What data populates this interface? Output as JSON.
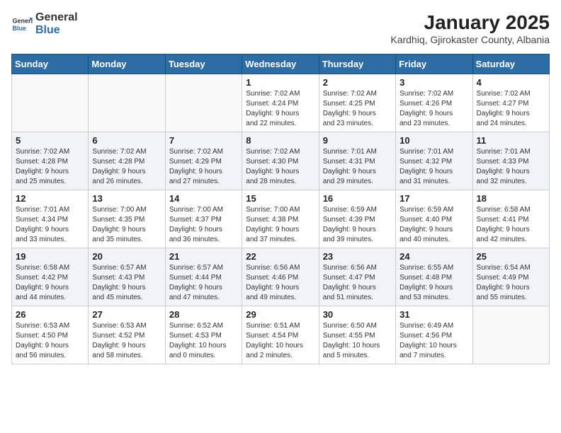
{
  "header": {
    "logo_general": "General",
    "logo_blue": "Blue",
    "title": "January 2025",
    "subtitle": "Kardhiq, Gjirokaster County, Albania"
  },
  "weekdays": [
    "Sunday",
    "Monday",
    "Tuesday",
    "Wednesday",
    "Thursday",
    "Friday",
    "Saturday"
  ],
  "weeks": [
    [
      {
        "day": "",
        "info": ""
      },
      {
        "day": "",
        "info": ""
      },
      {
        "day": "",
        "info": ""
      },
      {
        "day": "1",
        "info": "Sunrise: 7:02 AM\nSunset: 4:24 PM\nDaylight: 9 hours\nand 22 minutes."
      },
      {
        "day": "2",
        "info": "Sunrise: 7:02 AM\nSunset: 4:25 PM\nDaylight: 9 hours\nand 23 minutes."
      },
      {
        "day": "3",
        "info": "Sunrise: 7:02 AM\nSunset: 4:26 PM\nDaylight: 9 hours\nand 23 minutes."
      },
      {
        "day": "4",
        "info": "Sunrise: 7:02 AM\nSunset: 4:27 PM\nDaylight: 9 hours\nand 24 minutes."
      }
    ],
    [
      {
        "day": "5",
        "info": "Sunrise: 7:02 AM\nSunset: 4:28 PM\nDaylight: 9 hours\nand 25 minutes."
      },
      {
        "day": "6",
        "info": "Sunrise: 7:02 AM\nSunset: 4:28 PM\nDaylight: 9 hours\nand 26 minutes."
      },
      {
        "day": "7",
        "info": "Sunrise: 7:02 AM\nSunset: 4:29 PM\nDaylight: 9 hours\nand 27 minutes."
      },
      {
        "day": "8",
        "info": "Sunrise: 7:02 AM\nSunset: 4:30 PM\nDaylight: 9 hours\nand 28 minutes."
      },
      {
        "day": "9",
        "info": "Sunrise: 7:01 AM\nSunset: 4:31 PM\nDaylight: 9 hours\nand 29 minutes."
      },
      {
        "day": "10",
        "info": "Sunrise: 7:01 AM\nSunset: 4:32 PM\nDaylight: 9 hours\nand 31 minutes."
      },
      {
        "day": "11",
        "info": "Sunrise: 7:01 AM\nSunset: 4:33 PM\nDaylight: 9 hours\nand 32 minutes."
      }
    ],
    [
      {
        "day": "12",
        "info": "Sunrise: 7:01 AM\nSunset: 4:34 PM\nDaylight: 9 hours\nand 33 minutes."
      },
      {
        "day": "13",
        "info": "Sunrise: 7:00 AM\nSunset: 4:35 PM\nDaylight: 9 hours\nand 35 minutes."
      },
      {
        "day": "14",
        "info": "Sunrise: 7:00 AM\nSunset: 4:37 PM\nDaylight: 9 hours\nand 36 minutes."
      },
      {
        "day": "15",
        "info": "Sunrise: 7:00 AM\nSunset: 4:38 PM\nDaylight: 9 hours\nand 37 minutes."
      },
      {
        "day": "16",
        "info": "Sunrise: 6:59 AM\nSunset: 4:39 PM\nDaylight: 9 hours\nand 39 minutes."
      },
      {
        "day": "17",
        "info": "Sunrise: 6:59 AM\nSunset: 4:40 PM\nDaylight: 9 hours\nand 40 minutes."
      },
      {
        "day": "18",
        "info": "Sunrise: 6:58 AM\nSunset: 4:41 PM\nDaylight: 9 hours\nand 42 minutes."
      }
    ],
    [
      {
        "day": "19",
        "info": "Sunrise: 6:58 AM\nSunset: 4:42 PM\nDaylight: 9 hours\nand 44 minutes."
      },
      {
        "day": "20",
        "info": "Sunrise: 6:57 AM\nSunset: 4:43 PM\nDaylight: 9 hours\nand 45 minutes."
      },
      {
        "day": "21",
        "info": "Sunrise: 6:57 AM\nSunset: 4:44 PM\nDaylight: 9 hours\nand 47 minutes."
      },
      {
        "day": "22",
        "info": "Sunrise: 6:56 AM\nSunset: 4:46 PM\nDaylight: 9 hours\nand 49 minutes."
      },
      {
        "day": "23",
        "info": "Sunrise: 6:56 AM\nSunset: 4:47 PM\nDaylight: 9 hours\nand 51 minutes."
      },
      {
        "day": "24",
        "info": "Sunrise: 6:55 AM\nSunset: 4:48 PM\nDaylight: 9 hours\nand 53 minutes."
      },
      {
        "day": "25",
        "info": "Sunrise: 6:54 AM\nSunset: 4:49 PM\nDaylight: 9 hours\nand 55 minutes."
      }
    ],
    [
      {
        "day": "26",
        "info": "Sunrise: 6:53 AM\nSunset: 4:50 PM\nDaylight: 9 hours\nand 56 minutes."
      },
      {
        "day": "27",
        "info": "Sunrise: 6:53 AM\nSunset: 4:52 PM\nDaylight: 9 hours\nand 58 minutes."
      },
      {
        "day": "28",
        "info": "Sunrise: 6:52 AM\nSunset: 4:53 PM\nDaylight: 10 hours\nand 0 minutes."
      },
      {
        "day": "29",
        "info": "Sunrise: 6:51 AM\nSunset: 4:54 PM\nDaylight: 10 hours\nand 2 minutes."
      },
      {
        "day": "30",
        "info": "Sunrise: 6:50 AM\nSunset: 4:55 PM\nDaylight: 10 hours\nand 5 minutes."
      },
      {
        "day": "31",
        "info": "Sunrise: 6:49 AM\nSunset: 4:56 PM\nDaylight: 10 hours\nand 7 minutes."
      },
      {
        "day": "",
        "info": ""
      }
    ]
  ]
}
